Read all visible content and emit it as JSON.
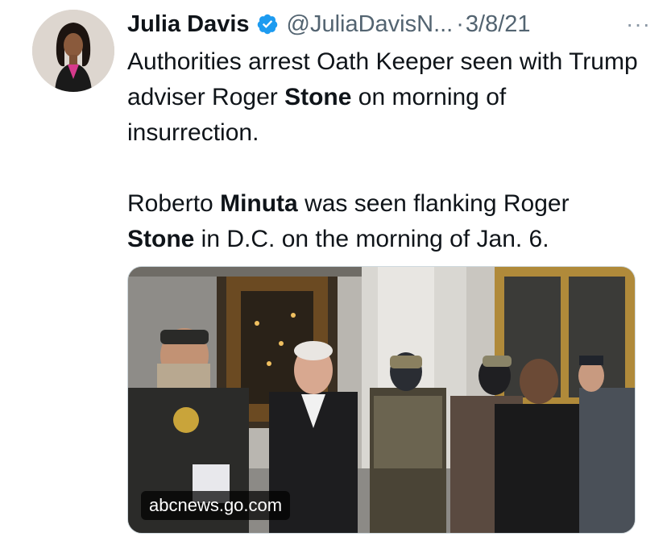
{
  "tweet": {
    "author_name": "Julia Davis",
    "handle": "@JuliaDavisN...",
    "separator": "·",
    "date": "3/8/21",
    "more_label": "···",
    "paragraphs": [
      [
        {
          "text": "Authorities arrest Oath Keeper seen with Trump adviser Roger ",
          "bold": false
        },
        {
          "text": "Stone",
          "bold": true
        },
        {
          "text": " on morning of insurrection.",
          "bold": false
        }
      ],
      [
        {
          "text": "Roberto ",
          "bold": false
        },
        {
          "text": "Minuta",
          "bold": true
        },
        {
          "text": " was seen flanking Roger ",
          "bold": false
        },
        {
          "text": "Stone",
          "bold": true
        },
        {
          "text": " in D.C. on the morning of Jan. 6.",
          "bold": false
        }
      ]
    ],
    "media": {
      "source_label": "abcnews.go.com"
    }
  },
  "colors": {
    "verified": "#1d9bf0",
    "secondary_text": "#536471",
    "primary_text": "#0f1419"
  },
  "icons": {
    "verified": "verified-badge-icon",
    "more": "more-options-icon"
  }
}
